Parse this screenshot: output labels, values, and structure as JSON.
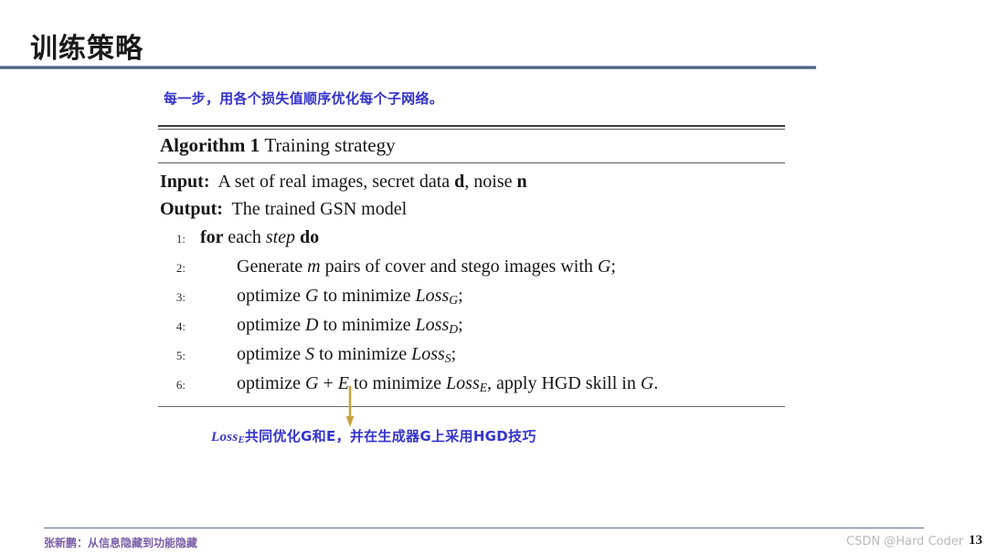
{
  "slide": {
    "title": "训练策略",
    "page_number": "13"
  },
  "captions": {
    "top": "每一步，用各个损失值顺序优化每个子网络。",
    "bottom_math_base": "Loss",
    "bottom_math_sub": "E",
    "bottom_rest": "共同优化G和E，并在生成器G上采用HGD技巧"
  },
  "algorithm": {
    "label": "Algorithm 1",
    "name": "Training strategy",
    "input_label": "Input:",
    "input_text_a": "A set of real images, secret data ",
    "input_bold_d": "d",
    "input_text_b": ", noise ",
    "input_bold_n": "n",
    "output_label": "Output:",
    "output_text": "The trained GSN model",
    "steps": [
      {
        "num": "1:",
        "indent": 1,
        "parts": [
          {
            "text": "for ",
            "style": "bold"
          },
          {
            "text": "each ",
            "style": "normal"
          },
          {
            "text": "step ",
            "style": "italic"
          },
          {
            "text": "do",
            "style": "bold"
          }
        ]
      },
      {
        "num": "2:",
        "indent": 2,
        "parts": [
          {
            "text": "Generate ",
            "style": "normal"
          },
          {
            "text": "m",
            "style": "italic"
          },
          {
            "text": " pairs of cover and stego images with ",
            "style": "normal"
          },
          {
            "text": "G",
            "style": "italic"
          },
          {
            "text": ";",
            "style": "normal"
          }
        ]
      },
      {
        "num": "3:",
        "indent": 2,
        "parts": [
          {
            "text": "optimize ",
            "style": "normal"
          },
          {
            "text": "G",
            "style": "italic"
          },
          {
            "text": " to minimize ",
            "style": "normal"
          },
          {
            "text": "Loss",
            "style": "italic"
          },
          {
            "text": "G",
            "style": "subscript"
          },
          {
            "text": ";",
            "style": "normal"
          }
        ]
      },
      {
        "num": "4:",
        "indent": 2,
        "parts": [
          {
            "text": "optimize ",
            "style": "normal"
          },
          {
            "text": "D",
            "style": "italic"
          },
          {
            "text": " to minimize ",
            "style": "normal"
          },
          {
            "text": "Loss",
            "style": "italic"
          },
          {
            "text": "D",
            "style": "subscript"
          },
          {
            "text": ";",
            "style": "normal"
          }
        ]
      },
      {
        "num": "5:",
        "indent": 2,
        "parts": [
          {
            "text": "optimize ",
            "style": "normal"
          },
          {
            "text": "S",
            "style": "italic"
          },
          {
            "text": " to minimize ",
            "style": "normal"
          },
          {
            "text": "Loss",
            "style": "italic"
          },
          {
            "text": "S",
            "style": "subscript"
          },
          {
            "text": ";",
            "style": "normal"
          }
        ]
      },
      {
        "num": "6:",
        "indent": 2,
        "parts": [
          {
            "text": "optimize ",
            "style": "normal"
          },
          {
            "text": "G",
            "style": "italic"
          },
          {
            "text": " + ",
            "style": "normal"
          },
          {
            "text": "E",
            "style": "italic"
          },
          {
            "text": " to minimize ",
            "style": "normal"
          },
          {
            "text": "Loss",
            "style": "italic"
          },
          {
            "text": "E",
            "style": "subscript"
          },
          {
            "text": ", apply HGD skill in ",
            "style": "normal"
          },
          {
            "text": "G",
            "style": "italic"
          },
          {
            "text": ".",
            "style": "normal"
          }
        ]
      }
    ]
  },
  "footer": {
    "text": "张新鹏：从信息隐藏到功能隐藏",
    "watermark": "CSDN @Hard Coder"
  },
  "colors": {
    "title_rule": "#4a6180",
    "caption_blue": "#3333cc",
    "arrow_gold": "#c9a martin",
    "arrow": "#c8a33f",
    "footer_purple": "#7b5fa8",
    "footer_rule": "#5f7392"
  }
}
